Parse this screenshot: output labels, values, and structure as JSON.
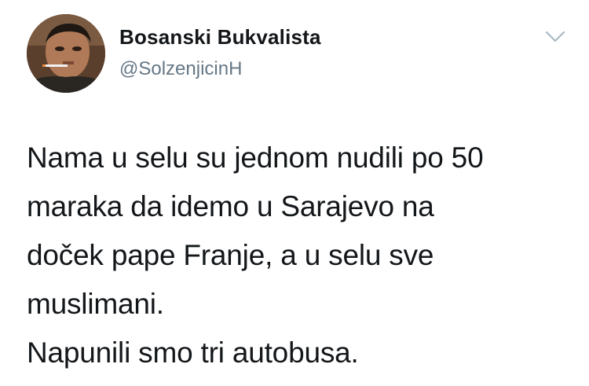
{
  "author": {
    "display_name": "Bosanski Bukvalista",
    "handle": "@SolzenjicinH",
    "avatar_icon": "profile-photo-icon"
  },
  "menu": {
    "icon": "chevron-down-icon"
  },
  "tweet": {
    "lines": [
      "Nama u selu su jednom nudili po 50",
      "maraka da idemo u Sarajevo na",
      "doček pape Franje, a u selu sve",
      "muslimani.",
      "Napunili smo tri autobusa."
    ]
  },
  "colors": {
    "text": "#14171a",
    "secondary": "#657786",
    "chevron": "#aab8c2",
    "background": "#ffffff"
  }
}
